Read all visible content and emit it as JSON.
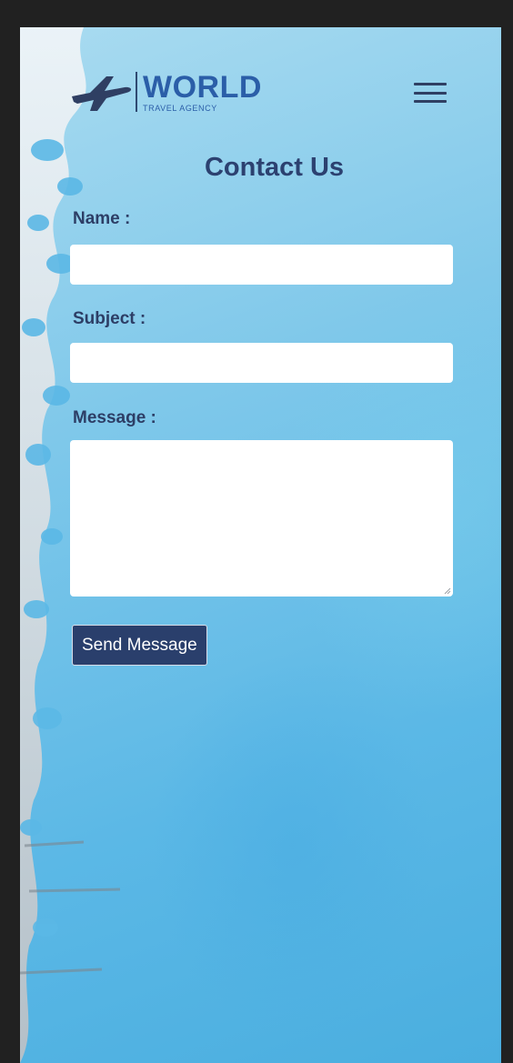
{
  "header": {
    "logo_main": "WORLD",
    "logo_sub": "TRAVEL AGENCY",
    "logo_icon": "airplane-icon",
    "menu_icon": "hamburger-icon"
  },
  "contact": {
    "title": "Contact Us",
    "name_label": "Name :",
    "name_value": "",
    "subject_label": "Subject :",
    "subject_value": "",
    "message_label": "Message :",
    "message_value": "",
    "send_label": "Send Message"
  },
  "colors": {
    "primary_dark": "#2a3f6c",
    "logo_blue": "#2b5ea8",
    "background_blue": "#7fc8ea",
    "frame": "#212121"
  }
}
